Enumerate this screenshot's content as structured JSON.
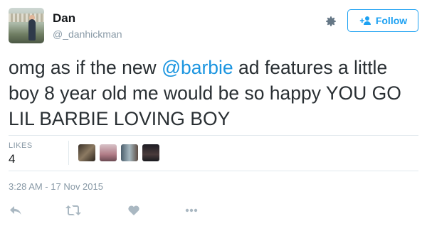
{
  "user": {
    "name": "Dan",
    "handle": "@_danhickman"
  },
  "follow_label": "Follow",
  "tweet": {
    "text_before": "omg as if the new ",
    "mention": "@barbie",
    "text_after": " ad features a little boy  8 year old me would be so happy YOU GO LIL BARBIE LOVING BOY"
  },
  "likes": {
    "label": "LIKES",
    "count": "4"
  },
  "timestamp": "3:28 AM - 17 Nov 2015",
  "colors": {
    "accent": "#1da1f2",
    "mention": "#1b95e0",
    "muted": "#8899a6"
  },
  "icons": [
    "user-avatar",
    "gear-icon",
    "add-user-icon",
    "reply-icon",
    "retweet-icon",
    "heart-icon",
    "more-dots-icon"
  ]
}
